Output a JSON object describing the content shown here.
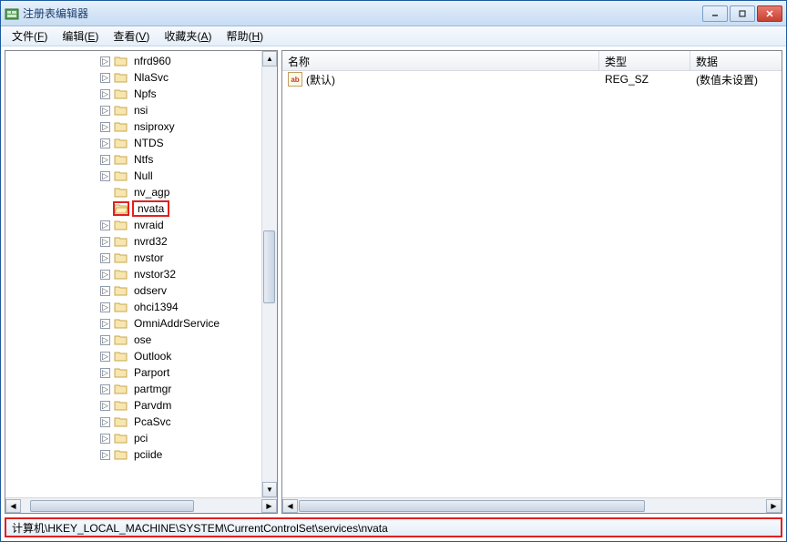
{
  "window": {
    "title": "注册表编辑器"
  },
  "menu": {
    "file": {
      "label": "文件",
      "hotkey": "F"
    },
    "edit": {
      "label": "编辑",
      "hotkey": "E"
    },
    "view": {
      "label": "查看",
      "hotkey": "V"
    },
    "favorites": {
      "label": "收藏夹",
      "hotkey": "A"
    },
    "help": {
      "label": "帮助",
      "hotkey": "H"
    }
  },
  "tree": {
    "items": [
      {
        "label": "nfrd960",
        "expandable": true,
        "selected": false
      },
      {
        "label": "NlaSvc",
        "expandable": true,
        "selected": false
      },
      {
        "label": "Npfs",
        "expandable": true,
        "selected": false
      },
      {
        "label": "nsi",
        "expandable": true,
        "selected": false
      },
      {
        "label": "nsiproxy",
        "expandable": true,
        "selected": false
      },
      {
        "label": "NTDS",
        "expandable": true,
        "selected": false
      },
      {
        "label": "Ntfs",
        "expandable": true,
        "selected": false
      },
      {
        "label": "Null",
        "expandable": true,
        "selected": false
      },
      {
        "label": "nv_agp",
        "expandable": false,
        "selected": false
      },
      {
        "label": "nvata",
        "expandable": false,
        "selected": true
      },
      {
        "label": "nvraid",
        "expandable": true,
        "selected": false
      },
      {
        "label": "nvrd32",
        "expandable": true,
        "selected": false
      },
      {
        "label": "nvstor",
        "expandable": true,
        "selected": false
      },
      {
        "label": "nvstor32",
        "expandable": true,
        "selected": false
      },
      {
        "label": "odserv",
        "expandable": true,
        "selected": false
      },
      {
        "label": "ohci1394",
        "expandable": true,
        "selected": false
      },
      {
        "label": "OmniAddrService",
        "expandable": true,
        "selected": false
      },
      {
        "label": "ose",
        "expandable": true,
        "selected": false
      },
      {
        "label": "Outlook",
        "expandable": true,
        "selected": false
      },
      {
        "label": "Parport",
        "expandable": true,
        "selected": false
      },
      {
        "label": "partmgr",
        "expandable": true,
        "selected": false
      },
      {
        "label": "Parvdm",
        "expandable": true,
        "selected": false
      },
      {
        "label": "PcaSvc",
        "expandable": true,
        "selected": false
      },
      {
        "label": "pci",
        "expandable": true,
        "selected": false
      },
      {
        "label": "pciide",
        "expandable": true,
        "selected": false
      }
    ]
  },
  "list": {
    "headers": {
      "name": "名称",
      "type": "类型",
      "data": "数据"
    },
    "rows": [
      {
        "name": "(默认)",
        "type": "REG_SZ",
        "data": "(数值未设置)",
        "icon": "ab"
      }
    ]
  },
  "statusbar": {
    "path": "计算机\\HKEY_LOCAL_MACHINE\\SYSTEM\\CurrentControlSet\\services\\nvata"
  }
}
